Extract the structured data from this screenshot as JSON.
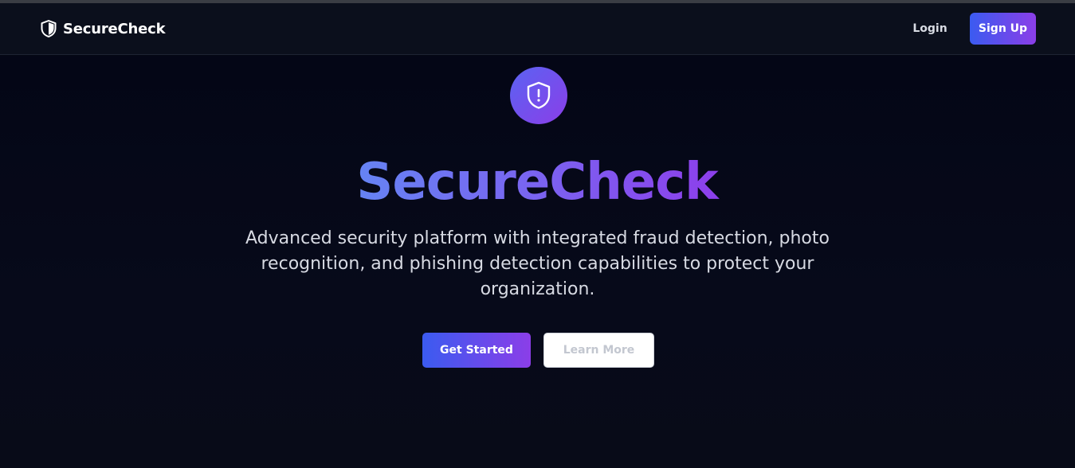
{
  "nav": {
    "brand": "SecureCheck",
    "brand_icon": "shield-icon",
    "login_label": "Login",
    "signup_label": "Sign Up"
  },
  "hero": {
    "icon": "shield-alert-icon",
    "title": "SecureCheck",
    "subtitle": "Advanced security platform with integrated fraud detection, photo recognition, and phishing detection capabilities to protect your organization.",
    "primary_button": "Get Started",
    "secondary_button": "Learn More"
  },
  "colors": {
    "background": "#050814",
    "navbar": "#0b0f1c",
    "gradient_start": "#3b5bf0",
    "gradient_end": "#8b3ee8",
    "title_gradient_start": "#5f8ef5",
    "title_gradient_end": "#9333ea",
    "text_muted": "#d7dae3"
  }
}
